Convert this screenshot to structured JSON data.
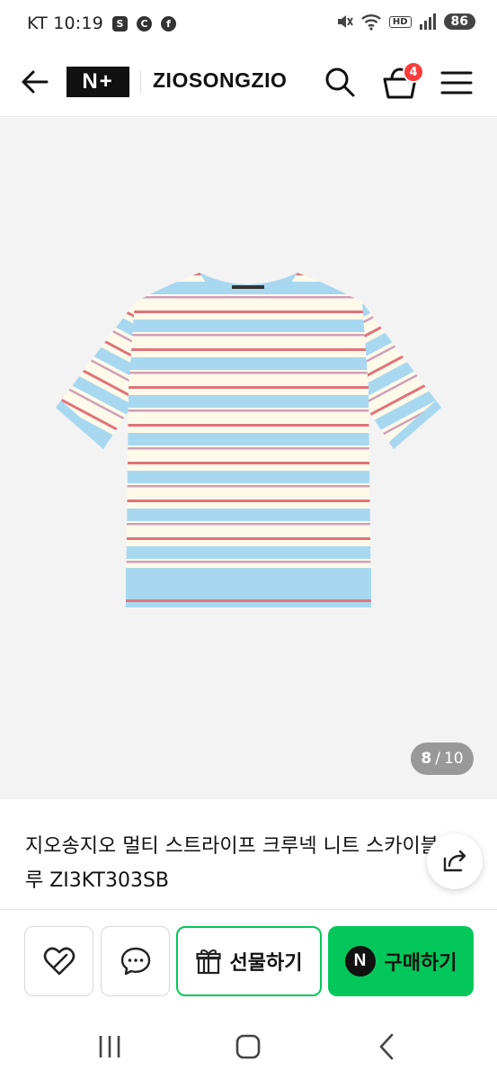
{
  "status_bar": {
    "carrier_time": "KT 10:19",
    "app_icons": [
      "S",
      "C",
      "f"
    ],
    "hd": "HD",
    "battery": "86"
  },
  "header": {
    "logo_text": "N+",
    "brand": "ZIOSONGZIO",
    "cart_count": "4"
  },
  "gallery": {
    "current": "8",
    "separator": "/",
    "total": "10"
  },
  "product": {
    "title": "지오송지오 멀티 스트라이프 크루넥 니트 스카이블루 ZI3KT303SB"
  },
  "actions": {
    "gift_label": "선물하기",
    "buy_label": "구매하기",
    "buy_icon_letter": "N"
  },
  "colors": {
    "naver_green": "#03c75a",
    "badge_red": "#ff3b3b",
    "stripe_blue": "#a8d8f0",
    "stripe_red": "#e0737a",
    "stripe_cream": "#fdfaea"
  }
}
